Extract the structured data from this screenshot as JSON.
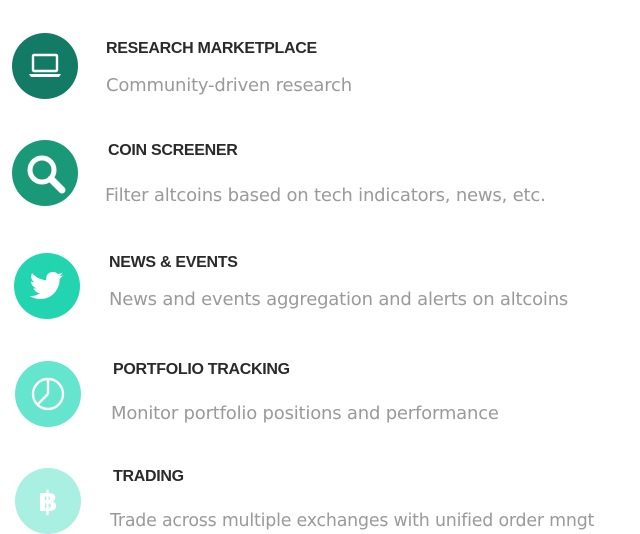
{
  "features": [
    {
      "title": "RESEARCH MARKETPLACE",
      "description": "Community-driven research",
      "icon": "laptop-icon",
      "color": "#137a66"
    },
    {
      "title": "COIN SCREENER",
      "description": "Filter altcoins based on tech indicators, news, etc.",
      "icon": "magnifier-icon",
      "color": "#1a9979"
    },
    {
      "title": "NEWS & EVENTS",
      "description": "News and events aggregation and alerts on altcoins",
      "icon": "twitter-bird-icon",
      "color": "#22d5b0"
    },
    {
      "title": "PORTFOLIO TRACKING",
      "description": "Monitor portfolio positions and performance",
      "icon": "pie-chart-icon",
      "color": "#66e5ce"
    },
    {
      "title": "TRADING",
      "description": "Trade across multiple exchanges with unified order mngt",
      "icon": "bitcoin-icon",
      "color": "#a9f0e3"
    }
  ]
}
